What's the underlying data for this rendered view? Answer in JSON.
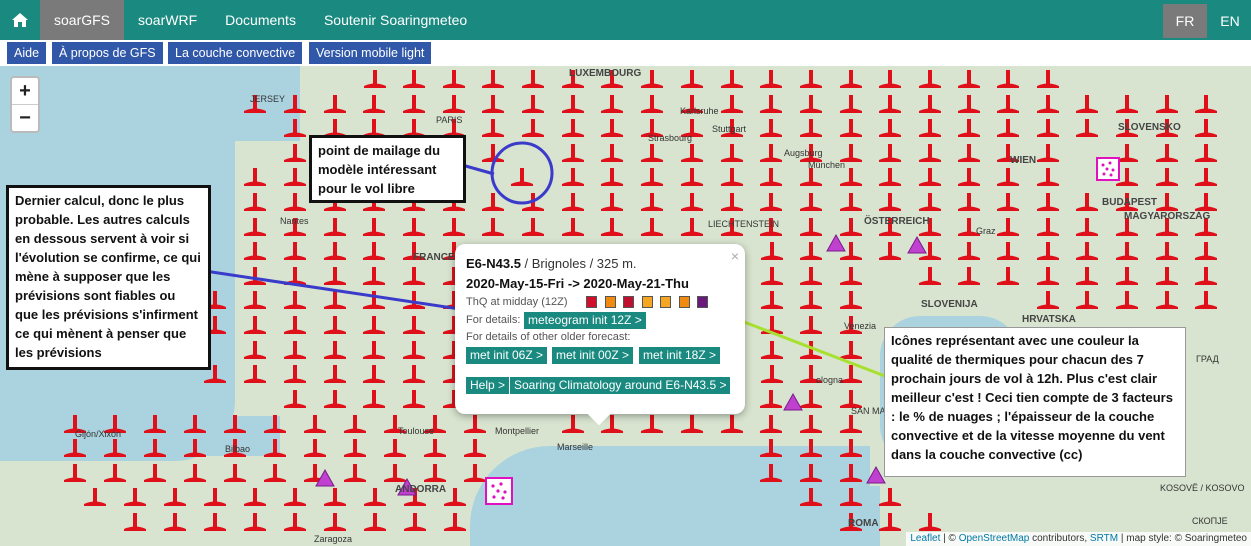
{
  "topnav": {
    "home_icon": "home-icon",
    "items": [
      {
        "label": "soarGFS"
      },
      {
        "label": "soarWRF"
      },
      {
        "label": "Documents"
      },
      {
        "label": "Soutenir Soaringmeteo"
      }
    ],
    "lang_fr": "FR",
    "lang_en": "EN"
  },
  "subnav": {
    "items": [
      {
        "label": "Aide"
      },
      {
        "label": "À propos de GFS"
      },
      {
        "label": "La couche convective"
      },
      {
        "label": "Version mobile light"
      }
    ]
  },
  "map": {
    "zoom_in": "+",
    "zoom_out": "−",
    "labels": {
      "jersey": "JERSEY",
      "paris": "PARIS",
      "luxembourg": "LUXEMBOURG",
      "strasbourg": "Strasbourg",
      "karlsruhe": "Karlsruhe",
      "stuttgart": "Stuttgart",
      "augsburg": "Augsburg",
      "munchen": "München",
      "wien": "WIEN",
      "slovensko": "SLOVENSKO",
      "budapest": "BUDAPEST",
      "magyarorszag": "MAGYARORSZÁG",
      "liechtenstein": "LIECHTENSTEIN",
      "osterreich": "ÖSTERREICH",
      "graz": "Graz",
      "nantes": "Nantes",
      "france": "FRANCE",
      "slovenija": "SLOVENIJA",
      "hrvatska": "HRVATSKA",
      "venezia": "Venezia",
      "bologna": "ologna",
      "san_marino": "SAN MARINO",
      "toulouse": "Toulouse",
      "montpellier": "Montpellier",
      "marseille": "Marseille",
      "andorra": "ANDORRA",
      "gijon": "Gijón/Xixón",
      "bilbao": "Bilbao",
      "zaragoza": "Zaragoza",
      "roma": "ROMA",
      "beograd": "ГРАД",
      "kosove": "KOSOVË / KOSOVO",
      "skopje": "СКОПЈЕ"
    }
  },
  "callouts": {
    "mesh": "point de mailage du modèle intéressant pour le vol libre",
    "last_calc": "Dernier calcul, donc le plus probable. Les autres calculs en dessous servent à voir si l'évolution se confirme, ce qui mène à supposer que les prévisions sont fiables ou que les prévisions s'infirment ce qui mènent à penser que les prévisions",
    "icons": "Icônes représentant avec une couleur la qualité de thermiques pour chacun des 7 prochain jours de vol à 12h. Plus c'est clair meilleur c'est ! Ceci tien compte de 3 facteurs : le % de nuages ; l'épaisseur de la couche convective et de la vitesse moyenne du vent dans la couche convective (cc)"
  },
  "popup": {
    "point_name": "E6-N43.5",
    "location": " / Brignoles / 325 m.",
    "date_range": "2020-May-15-Fri -> 2020-May-21-Thu",
    "thq_label": "ThQ at midday (12Z)",
    "details_label": "For details:",
    "meteogram_btn": "meteogram init 12Z >",
    "older_label": "For details of other older forecast:",
    "older_btns": [
      "met init 06Z >",
      "met init 00Z >",
      "met init 18Z >"
    ],
    "help_btn": "Help >",
    "climato_btn": "Soaring Climatology around E6-N43.5 >",
    "close": "×",
    "thq_colors": [
      "#d0102a",
      "#f08a10",
      "#c01030",
      "#f5a623",
      "#f5a623",
      "#f08a10",
      "#6a1a7a"
    ]
  },
  "attribution": {
    "leaflet": "Leaflet",
    "sep1": " | © ",
    "osm": "OpenStreetMap",
    "contrib": " contributors, ",
    "srtm": "SRTM",
    "style": " | map style: © Soaringmeteo"
  },
  "colors": {
    "brand": "#1a8a80",
    "subnav": "#3057a8",
    "marker": "#e0101a"
  }
}
